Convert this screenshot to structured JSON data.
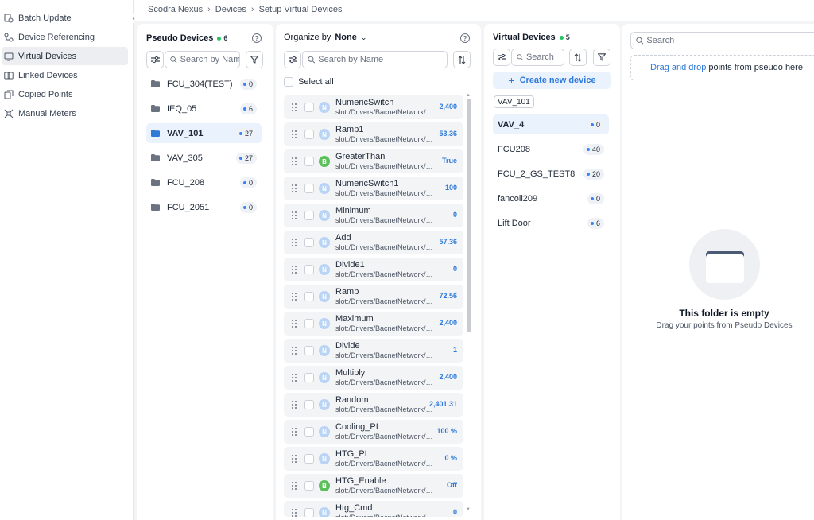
{
  "sidebar": {
    "items": [
      {
        "label": "Batch Update",
        "icon": "batch-update-icon"
      },
      {
        "label": "Device Referencing",
        "icon": "device-referencing-icon"
      },
      {
        "label": "Virtual Devices",
        "icon": "virtual-devices-icon",
        "active": true
      },
      {
        "label": "Linked Devices",
        "icon": "link-icon"
      },
      {
        "label": "Copied Points",
        "icon": "copy-icon"
      },
      {
        "label": "Manual Meters",
        "icon": "manual-meters-icon"
      }
    ]
  },
  "breadcrumb": [
    "Scodra Nexus",
    "Devices",
    "Setup Virtual Devices"
  ],
  "pseudo": {
    "title": "Pseudo Devices",
    "count": "6",
    "search_placeholder": "Search by Name",
    "devices": [
      {
        "name": "FCU_304(TEST)",
        "count": "0"
      },
      {
        "name": "IEQ_05",
        "count": "6"
      },
      {
        "name": "VAV_101",
        "count": "27",
        "active": true
      },
      {
        "name": "VAV_305",
        "count": "27"
      },
      {
        "name": "FCU_208",
        "count": "0"
      },
      {
        "name": "FCU_2051",
        "count": "0"
      }
    ]
  },
  "organize": {
    "label": "Organize by",
    "value": "None",
    "search_placeholder": "Search by Name",
    "select_all": "Select all",
    "points": [
      {
        "type": "N",
        "name": "NumericSwitch",
        "path": "slot:/Drivers/BacnetNetwork/HVAC",
        "value": "2,400"
      },
      {
        "type": "N",
        "name": "Ramp1",
        "path": "slot:/Drivers/BacnetNetwork/HVAC",
        "value": "53.36"
      },
      {
        "type": "B",
        "name": "GreaterThan",
        "path": "slot:/Drivers/BacnetNetwork/HVAC",
        "value": "True"
      },
      {
        "type": "N",
        "name": "NumericSwitch1",
        "path": "slot:/Drivers/BacnetNetwork/HVAC",
        "value": "100"
      },
      {
        "type": "N",
        "name": "Minimum",
        "path": "slot:/Drivers/BacnetNetwork/HVAC",
        "value": "0"
      },
      {
        "type": "N",
        "name": "Add",
        "path": "slot:/Drivers/BacnetNetwork/HVAC",
        "value": "57.36"
      },
      {
        "type": "N",
        "name": "Divide1",
        "path": "slot:/Drivers/BacnetNetwork/HVAC",
        "value": "0"
      },
      {
        "type": "N",
        "name": "Ramp",
        "path": "slot:/Drivers/BacnetNetwork/HVAC",
        "value": "72.56"
      },
      {
        "type": "N",
        "name": "Maximum",
        "path": "slot:/Drivers/BacnetNetwork/HVAC",
        "value": "2,400"
      },
      {
        "type": "N",
        "name": "Divide",
        "path": "slot:/Drivers/BacnetNetwork/HVAC",
        "value": "1"
      },
      {
        "type": "N",
        "name": "Multiply",
        "path": "slot:/Drivers/BacnetNetwork/HVAC",
        "value": "2,400"
      },
      {
        "type": "N",
        "name": "Random",
        "path": "slot:/Drivers/BacnetNetwork/HVAC",
        "value": "2,401.31"
      },
      {
        "type": "N",
        "name": "Cooling_PI",
        "path": "slot:/Drivers/BacnetNetwork/HVAC",
        "value": "100 %"
      },
      {
        "type": "N",
        "name": "HTG_PI",
        "path": "slot:/Drivers/BacnetNetwork/HVAC",
        "value": "0 %"
      },
      {
        "type": "B",
        "name": "HTG_Enable",
        "path": "slot:/Drivers/BacnetNetwork/HVAC",
        "value": "Off"
      },
      {
        "type": "N",
        "name": "Htg_Cmd",
        "path": "slot:/Drivers/BacnetNetwork/HVAC",
        "value": "0"
      }
    ]
  },
  "virtual": {
    "title": "Virtual Devices",
    "count": "5",
    "search_placeholder": "Search",
    "create_label": "Create new device",
    "filter_chip": "VAV_101",
    "devices": [
      {
        "name": "VAV_4",
        "count": "0",
        "active": true
      },
      {
        "name": "FCU208",
        "count": "40"
      },
      {
        "name": "FCU_2_GS_TEST8",
        "count": "20"
      },
      {
        "name": "fancoil209",
        "count": "0"
      },
      {
        "name": "Lift Door",
        "count": "6"
      }
    ]
  },
  "right": {
    "search_placeholder": "Search",
    "drop_link": "Drag and drop",
    "drop_text": "points from pseudo here",
    "empty_title": "This folder is empty",
    "empty_sub": "Drag your points from Pseudo Devices"
  },
  "colors": {
    "accent": "#2f7ad9",
    "success": "#22c55e",
    "boolean": "#5bbf5a",
    "numeric": "#b9d4f4"
  }
}
